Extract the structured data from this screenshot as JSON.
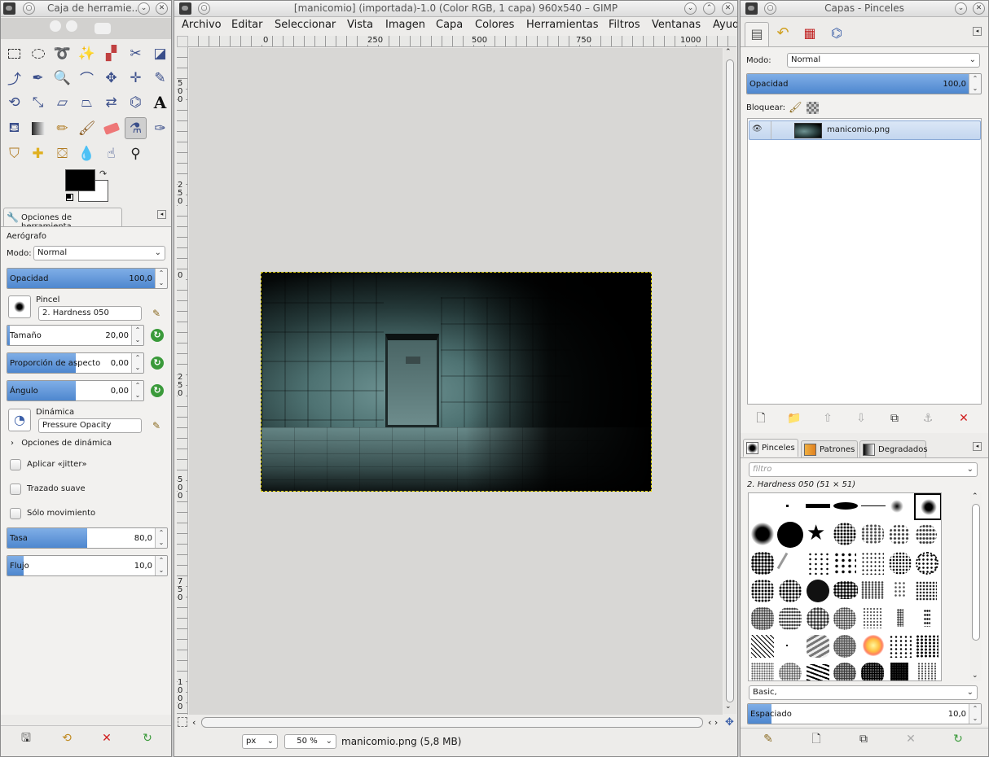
{
  "toolbox": {
    "title": "Caja de herramie...",
    "tool_options_tab": "Opciones de herramienta",
    "tool_name": "Aerógrafo",
    "mode_label": "Modo:",
    "mode_value": "Normal",
    "opacity_label": "Opacidad",
    "opacity_value": "100,0",
    "opacity_fraction": 1.0,
    "brush_label": "Pincel",
    "brush_value": "2. Hardness 050",
    "size_label": "Tamaño",
    "size_value": "20,00",
    "size_fraction": 0.02,
    "aspect_label": "Proporción de aspecto",
    "aspect_value": "0,00",
    "aspect_fraction": 0.5,
    "angle_label": "Ángulo",
    "angle_value": "0,00",
    "angle_fraction": 0.5,
    "dynamics_label": "Dinámica",
    "dynamics_value": "Pressure Opacity",
    "dynamics_options": "Opciones de dinámica",
    "jitter_label": "Aplicar «jitter»",
    "smooth_label": "Trazado suave",
    "motion_label": "Sólo movimiento",
    "rate_label": "Tasa",
    "rate_value": "80,0",
    "rate_fraction": 0.5,
    "flow_label": "Flujo",
    "flow_value": "10,0",
    "flow_fraction": 0.1
  },
  "image_window": {
    "title": "[manicomio] (importada)-1.0 (Color RGB, 1 capa) 960x540 – GIMP",
    "menu": [
      "Archivo",
      "Editar",
      "Seleccionar",
      "Vista",
      "Imagen",
      "Capa",
      "Colores",
      "Herramientas",
      "Filtros",
      "Ventanas",
      "Ayud"
    ],
    "hruler_ticks": [
      "0",
      "250",
      "500",
      "750",
      "1000"
    ],
    "vruler_ticks": [
      "500",
      "250",
      "0",
      "250",
      "500",
      "750",
      "1000"
    ],
    "unit": "px",
    "zoom": "50 %",
    "status": "manicomio.png (5,8 MB)"
  },
  "layers_dock": {
    "title": "Capas - Pinceles",
    "mode_label": "Modo:",
    "mode_value": "Normal",
    "opacity_label": "Opacidad",
    "opacity_value": "100,0",
    "opacity_fraction": 1.0,
    "lock_label": "Bloquear:",
    "layer_name": "manicomio.png"
  },
  "brushes_dock": {
    "tabs": [
      "Pinceles",
      "Patrones",
      "Degradados"
    ],
    "filter_placeholder": "filtro",
    "current_brush": "2. Hardness 050 (51 × 51)",
    "tag_value": "Basic,",
    "spacing_label": "Espaciado",
    "spacing_value": "10,0",
    "spacing_fraction": 0.1
  }
}
